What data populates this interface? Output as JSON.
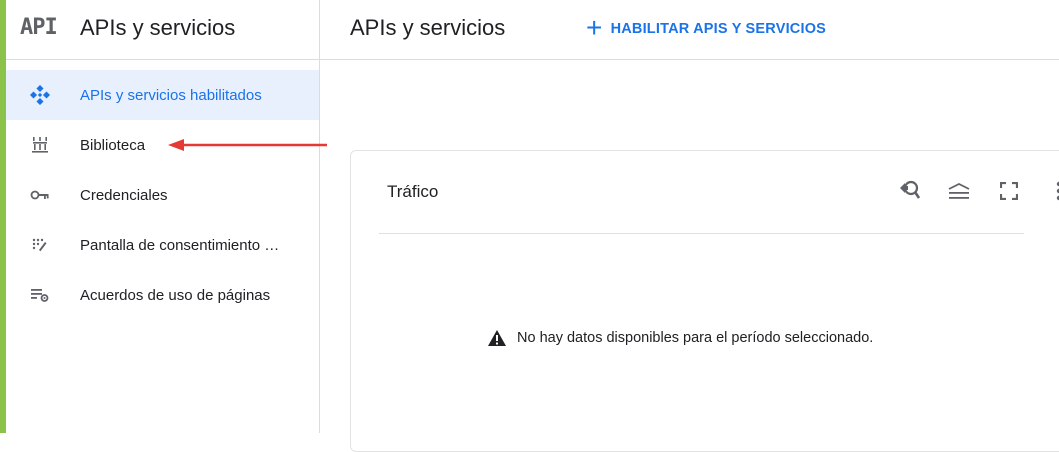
{
  "sidebar": {
    "logo": "API",
    "title": "APIs y servicios",
    "items": [
      {
        "label": "APIs y servicios habilitados",
        "icon": "diamond-dots-icon",
        "active": true
      },
      {
        "label": "Biblioteca",
        "icon": "library-icon",
        "active": false
      },
      {
        "label": "Credenciales",
        "icon": "key-icon",
        "active": false
      },
      {
        "label": "Pantalla de consentimiento …",
        "icon": "consent-dots-icon",
        "active": false
      },
      {
        "label": "Acuerdos de uso de páginas",
        "icon": "list-settings-icon",
        "active": false
      }
    ]
  },
  "header": {
    "title": "APIs y servicios",
    "enable_button": "HABILITAR APIS Y SERVICIOS"
  },
  "traffic_card": {
    "title": "Tráfico",
    "tools": [
      "zoom-reset-icon",
      "legend-icon",
      "fullscreen-icon",
      "more-vert-icon"
    ],
    "empty_message": "No hay datos disponibles para el período seleccionado."
  },
  "colors": {
    "accent_bar": "#8bc34a",
    "primary": "#1a73e8",
    "active_bg": "#e8f0fe",
    "annotation_arrow": "#e53935"
  }
}
